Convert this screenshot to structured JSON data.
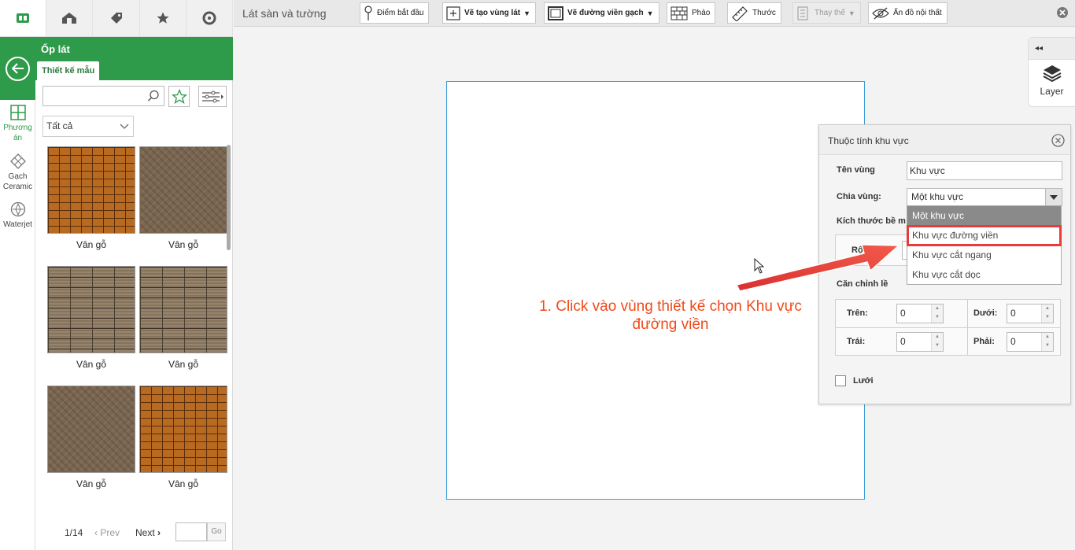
{
  "left_nav": {
    "icons": [
      "app-logo-icon",
      "home-layout-icon",
      "tag-icon",
      "star-icon",
      "search-icon"
    ]
  },
  "rail": {
    "items": [
      {
        "label": "Phương án",
        "icon": "layout-plan-icon",
        "active": true
      },
      {
        "label": "Gạch Ceramic",
        "icon": "tile-diamond-icon",
        "active": false
      },
      {
        "label": "Waterjet",
        "icon": "waterjet-icon",
        "active": false
      }
    ]
  },
  "panel": {
    "title": "Ốp lát",
    "tab": "Thiết kế mẫu",
    "search_value": "",
    "filter_select": "Tất cả",
    "tiles": [
      {
        "caption": "Vân gỗ",
        "pattern": "brick"
      },
      {
        "caption": "Vân gỗ",
        "pattern": "herring"
      },
      {
        "caption": "Vân gỗ",
        "pattern": "woodgray"
      },
      {
        "caption": "Vân gỗ",
        "pattern": "woodgray"
      },
      {
        "caption": "Vân gỗ",
        "pattern": "herring"
      },
      {
        "caption": "Vân gỗ",
        "pattern": "brick"
      }
    ],
    "pager": {
      "page": "1/14",
      "prev": "Prev",
      "next": "Next",
      "go_value": "",
      "go": "Go"
    }
  },
  "toolbar": {
    "title": "Lát sàn và tường",
    "buttons": {
      "start_point": "Điểm bắt đầu",
      "draw_area": "Vẽ tạo vùng lát",
      "draw_border": "Vẽ đường viền gạch",
      "cornice": "Phào",
      "ruler": "Thước",
      "replace": "Thay thế",
      "hide_furniture": "Ẩn đồ nội thất"
    }
  },
  "layer_tab": {
    "collapse": "◂◂",
    "label": "Layer"
  },
  "properties": {
    "title": "Thuộc tính khu vực",
    "region_name_label": "Tên vùng",
    "region_name_value": "Khu vực",
    "split_label": "Chia vùng:",
    "split_value": "Một khu vực",
    "edge_size_label": "Kích thước bề m",
    "width_label": "Rộn",
    "align_label": "Căn chỉnh lề",
    "top_label": "Trên:",
    "top_value": "0",
    "bottom_label": "Dưới:",
    "bottom_value": "0",
    "left_label": "Trái:",
    "left_value": "0",
    "right_label": "Phải:",
    "right_value": "0",
    "grid_label": "Lưới"
  },
  "dropdown": {
    "options": [
      "Một khu vực",
      "Khu vực đường viền",
      "Khu vực cắt ngang",
      "Khu vực cắt dọc"
    ],
    "selected_index": 0,
    "highlighted_index": 1
  },
  "annotation": {
    "line1": "1. Click vào vùng thiết kế chọn Khu vực",
    "line2": "đường viền"
  },
  "colors": {
    "brand_green": "#2e9b4a",
    "annotation": "#f04a1a",
    "canvas_border": "#3a9bd5",
    "highlight_red": "#e53c3c"
  }
}
